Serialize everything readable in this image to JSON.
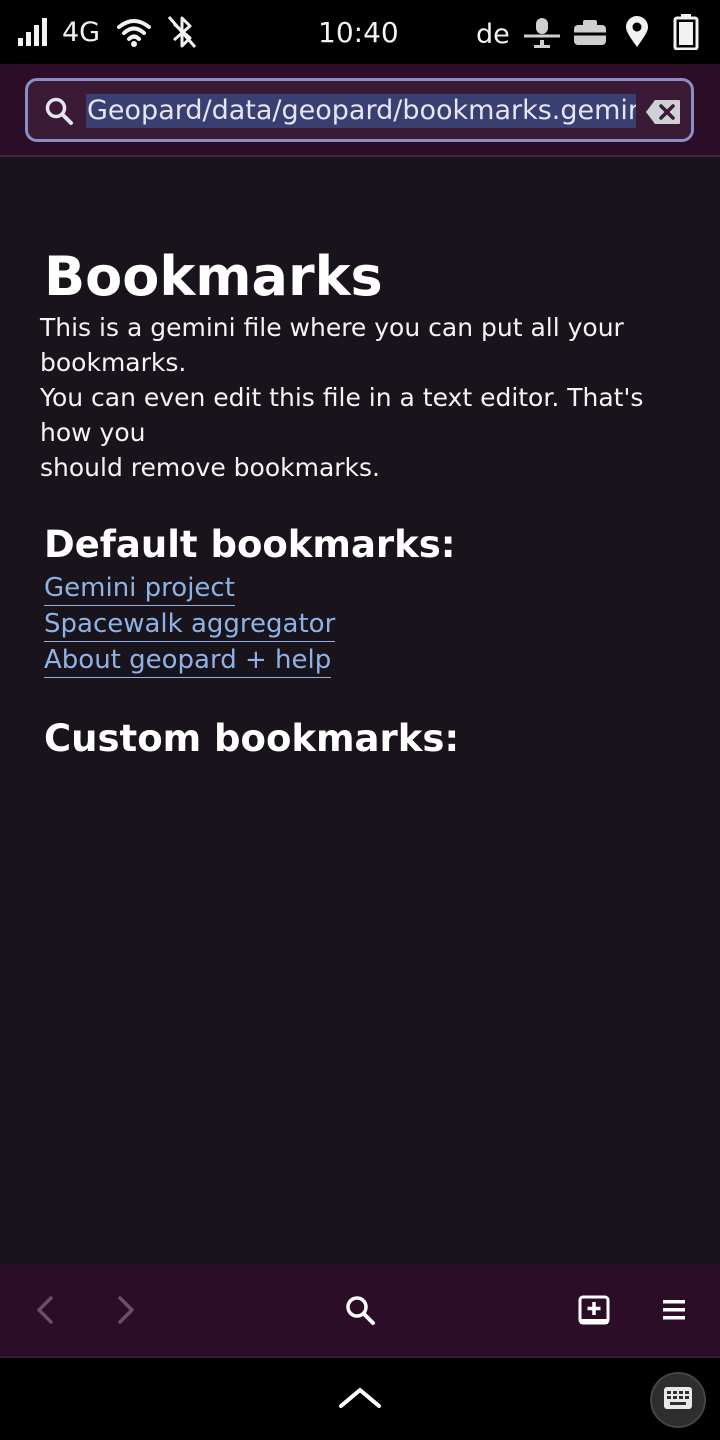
{
  "status_bar": {
    "network_type": "4G",
    "time": "10:40",
    "keyboard_layout": "de",
    "icons": [
      "signal-icon",
      "wifi-icon",
      "bluetooth-off-icon",
      "microphone-muted-icon",
      "camera-muted-icon",
      "location-icon",
      "battery-icon"
    ]
  },
  "url_bar": {
    "value": "Geopard/data/geopard/bookmarks.gemini",
    "search_icon": "search-icon",
    "clear_icon": "backspace-clear-icon"
  },
  "page": {
    "title": "Bookmarks",
    "paragraph_lines": [
      " This is a gemini file where you can put all your",
      "bookmarks.",
      " You can even edit this file in a text editor. That's",
      "how you",
      " should remove bookmarks."
    ],
    "default_heading": "Default bookmarks:",
    "links": [
      {
        "label": "Gemini project"
      },
      {
        "label": "Spacewalk aggregator"
      },
      {
        "label": "About geopard + help"
      }
    ],
    "custom_heading": "Custom bookmarks:"
  },
  "toolbar": {
    "back_icon": "back-arrow-icon",
    "forward_icon": "forward-arrow-icon",
    "search_icon": "search-icon",
    "add_bookmark_icon": "add-bookmark-icon",
    "menu_icon": "hamburger-menu-icon"
  },
  "nav_bar": {
    "expand_icon": "chevron-up-icon",
    "keyboard_icon": "keyboard-icon"
  },
  "colors": {
    "background": "#19141b",
    "header": "#2c0d27",
    "link": "#8fb2e6",
    "url_border": "#8a8ec4",
    "url_selection": "#3a3f72"
  }
}
